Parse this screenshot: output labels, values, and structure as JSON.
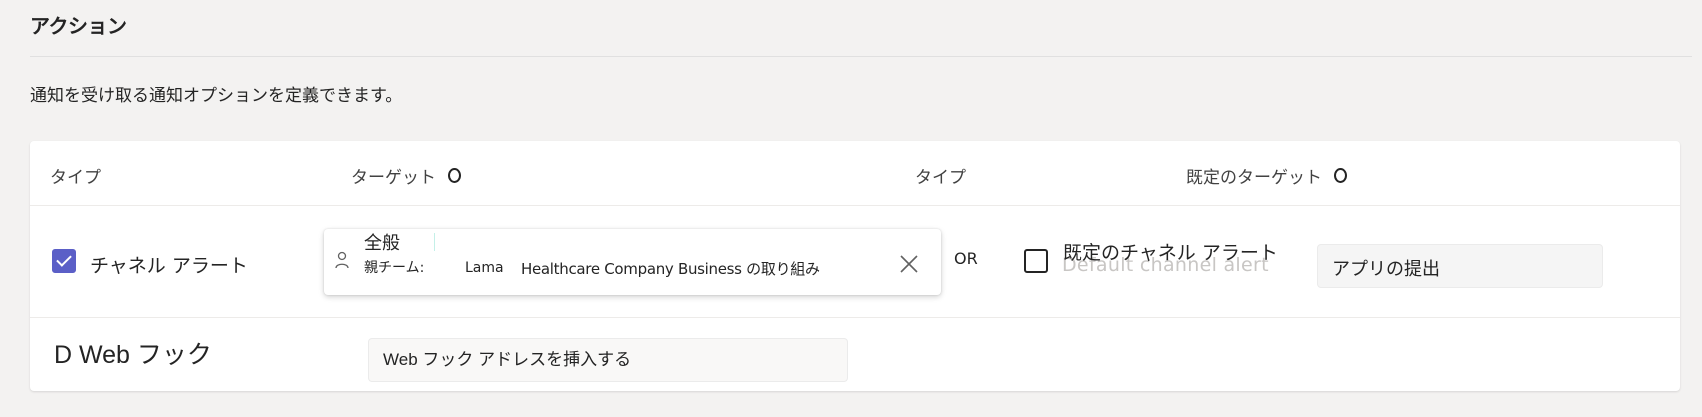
{
  "section": {
    "title": "アクション",
    "description": "通知を受け取る通知オプションを定義できます。"
  },
  "table": {
    "headers": {
      "type_left": "タイプ",
      "target": "ターゲット",
      "type_right": "タイプ",
      "default_target": "既定のターゲット"
    },
    "channel_row": {
      "checkbox_checked": true,
      "label": "チャネル アラート",
      "picker": {
        "channel": "全般",
        "parent_team_label": "親チーム:",
        "team_name": "Lama",
        "organization": "Healthcare Company Business の取り組み",
        "person_icon": "person-icon",
        "close_icon": "close-icon"
      },
      "or_label": "OR",
      "default_checkbox_checked": false,
      "default_label": "既定のチャネル アラート",
      "default_label_ghost": "Default channel alert",
      "default_target_value": "アプリの提出"
    },
    "webhook_row": {
      "label": "D Web フック",
      "placeholder": "Web フック アドレスを挿入する"
    }
  },
  "colors": {
    "accent": "#5b5fc7",
    "background": "#f3f2f1",
    "card": "#ffffff"
  }
}
